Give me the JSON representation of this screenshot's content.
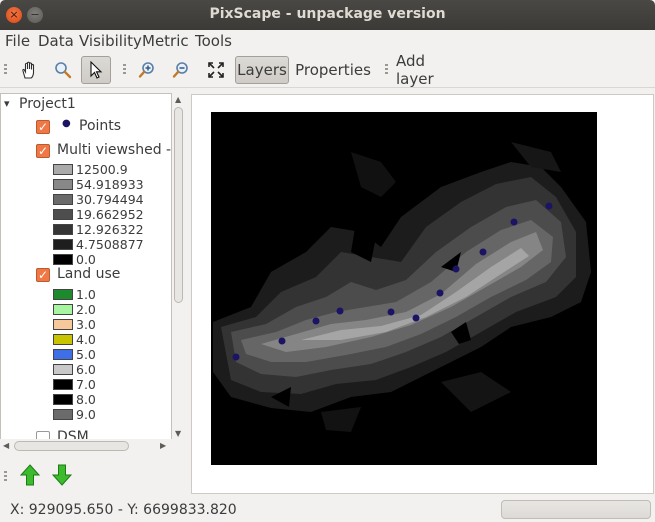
{
  "window": {
    "title": "PixScape - unpackage version",
    "close_glyph": "×",
    "minimize_glyph": "−"
  },
  "menu": [
    "File",
    "Data",
    "Visibility",
    "Metric",
    "Tools"
  ],
  "toolbar": {
    "pan_icon": "hand-icon",
    "zoom_icon": "magnifier-icon",
    "select_icon": "pointer-icon",
    "zoom_in_icon": "zoom-in-icon",
    "zoom_out_icon": "zoom-out-icon",
    "zoom_extent_icon": "fullscreen-icon",
    "layers_label": "Layers",
    "properties_label": "Properties",
    "add_layer_label": "Add layer"
  },
  "tree": {
    "project": "Project1",
    "expand_glyph": "▾",
    "layers": [
      {
        "label": "Points",
        "checked": true
      },
      {
        "label": "Multi viewshed -",
        "checked": true,
        "legend": [
          {
            "value": "12500.9",
            "color": "#aaaaaa"
          },
          {
            "value": "54.918933",
            "color": "#888888"
          },
          {
            "value": "30.794494",
            "color": "#6a6a6a"
          },
          {
            "value": "19.662952",
            "color": "#4e4e4e"
          },
          {
            "value": "12.926322",
            "color": "#363636"
          },
          {
            "value": "4.7508877",
            "color": "#1e1e1e"
          },
          {
            "value": "0.0",
            "color": "#000000"
          }
        ]
      },
      {
        "label": "Land use",
        "checked": true,
        "legend": [
          {
            "value": "1.0",
            "color": "#1d8a2d"
          },
          {
            "value": "2.0",
            "color": "#a6f5a0"
          },
          {
            "value": "3.0",
            "color": "#f7c99a"
          },
          {
            "value": "4.0",
            "color": "#c8c400"
          },
          {
            "value": "5.0",
            "color": "#3f6fe6"
          },
          {
            "value": "6.0",
            "color": "#c9c9c9"
          },
          {
            "value": "7.0",
            "color": "#000000"
          },
          {
            "value": "8.0",
            "color": "#000000"
          },
          {
            "value": "9.0",
            "color": "#6b6b6b"
          }
        ]
      },
      {
        "label": "DSM",
        "checked": false
      }
    ],
    "check_glyph": "✓",
    "point_glyph": "●"
  },
  "sidebar_buttons": {
    "up_icon": "arrow-up-icon",
    "down_icon": "arrow-down-icon"
  },
  "status": {
    "coords": "X: 929095.650 - Y: 6699833.820"
  },
  "map": {
    "point_color": "#1b1464"
  }
}
